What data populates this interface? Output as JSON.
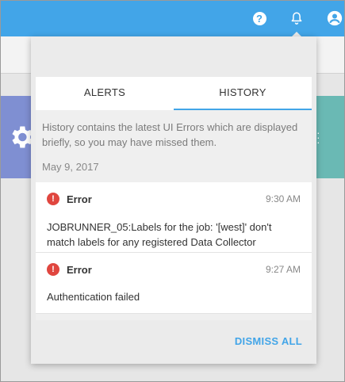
{
  "topbar": {
    "icons": [
      "help-icon",
      "bell-icon",
      "user-account-icon"
    ],
    "help_glyph": "?",
    "accent_color": "#42a5e8"
  },
  "background": {
    "left_card_color": "#7f8fd2",
    "right_card_color": "#6ab9b4"
  },
  "notifications": {
    "tabs": [
      {
        "label": "ALERTS",
        "active": false
      },
      {
        "label": "HISTORY",
        "active": true
      }
    ],
    "history": {
      "intro": "History contains the latest UI Errors which are displayed briefly, so you may have missed them.",
      "date": "May 9, 2017",
      "entries": [
        {
          "icon": "error-icon",
          "icon_glyph": "!",
          "title": "Error",
          "time": "9:30 AM",
          "message": "JOBRUNNER_05:Labels for the job: '[west]' don't match labels for any registered Data Collector"
        },
        {
          "icon": "error-icon",
          "icon_glyph": "!",
          "title": "Error",
          "time": "9:27 AM",
          "message": "Authentication failed"
        }
      ]
    },
    "dismiss_label": "DISMISS ALL",
    "error_color": "#e0463f"
  }
}
